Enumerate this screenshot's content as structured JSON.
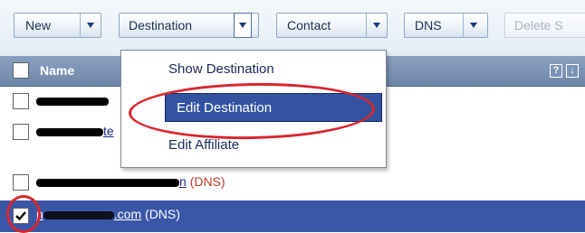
{
  "toolbar": {
    "new_label": "New",
    "destination_label": "Destination",
    "contact_label": "Contact",
    "dns_label": "DNS",
    "delete_label": "Delete S"
  },
  "grid": {
    "column_name": "Name",
    "help_icon_glyph": "?",
    "sort_icon_glyph": "↓",
    "rows": [
      {
        "suffix": "",
        "tag": "",
        "checked": false
      },
      {
        "suffix": "te",
        "tag": "",
        "checked": false
      },
      {
        "suffix": "n",
        "tag": "(DNS)",
        "checked": false
      },
      {
        "prefix": "n",
        "suffix": ".com",
        "tag": "(DNS)",
        "checked": true
      }
    ]
  },
  "menu": {
    "items": [
      "Show Destination",
      "Edit Destination",
      "Edit Affiliate"
    ],
    "highlighted_index": 1
  },
  "colors": {
    "selection": "#3b56a6",
    "annotation": "#d8262d",
    "header": "#7b93b6"
  }
}
